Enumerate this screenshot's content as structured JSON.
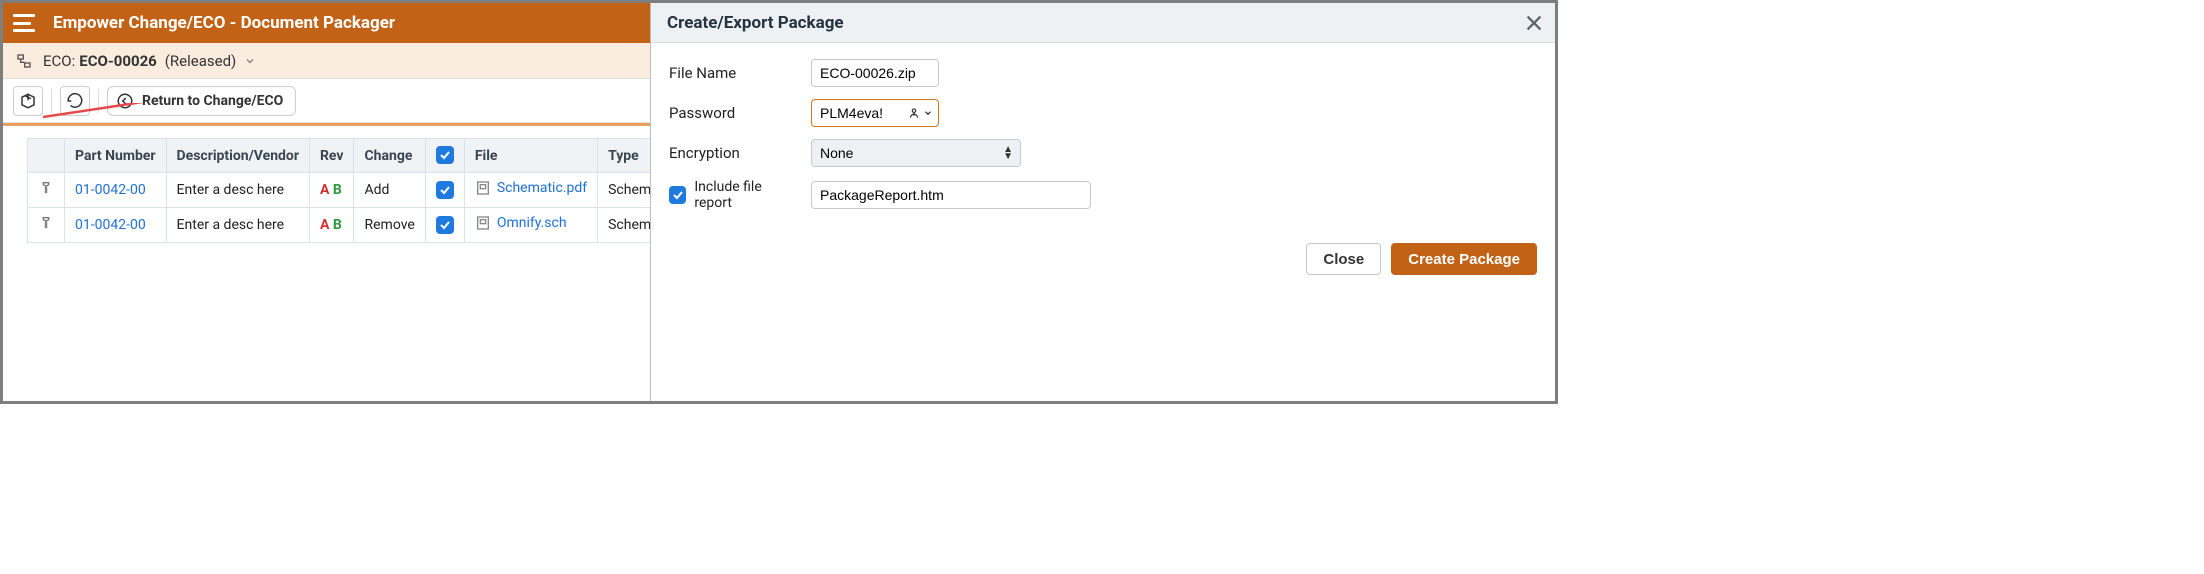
{
  "header": {
    "title": "Empower Change/ECO - Document Packager"
  },
  "eco_bar": {
    "label": "ECO:",
    "number": "ECO-00026",
    "status": "(Released)"
  },
  "toolbar": {
    "return_label": "Return to Change/ECO"
  },
  "table": {
    "headers": {
      "part": "Part Number",
      "desc": "Description/Vendor",
      "rev": "Rev",
      "change": "Change",
      "file": "File",
      "type": "Type"
    },
    "rows": [
      {
        "part": "01-0042-00",
        "desc": "Enter a desc here",
        "rev_a": "A",
        "rev_b": "B",
        "change": "Add",
        "file": "Schematic.pdf",
        "type": "Schematic PDF"
      },
      {
        "part": "01-0042-00",
        "desc": "Enter a desc here",
        "rev_a": "A",
        "rev_b": "B",
        "change": "Remove",
        "file": "Omnify.sch",
        "type": "Schematic"
      }
    ]
  },
  "modal": {
    "title": "Create/Export Package",
    "labels": {
      "filename": "File Name",
      "password": "Password",
      "encryption": "Encryption",
      "include_report": "Include file report"
    },
    "values": {
      "filename": "ECO-00026.zip",
      "password": "PLM4eva!",
      "encryption": "None",
      "report_file": "PackageReport.htm"
    },
    "buttons": {
      "close": "Close",
      "create": "Create Package"
    }
  }
}
